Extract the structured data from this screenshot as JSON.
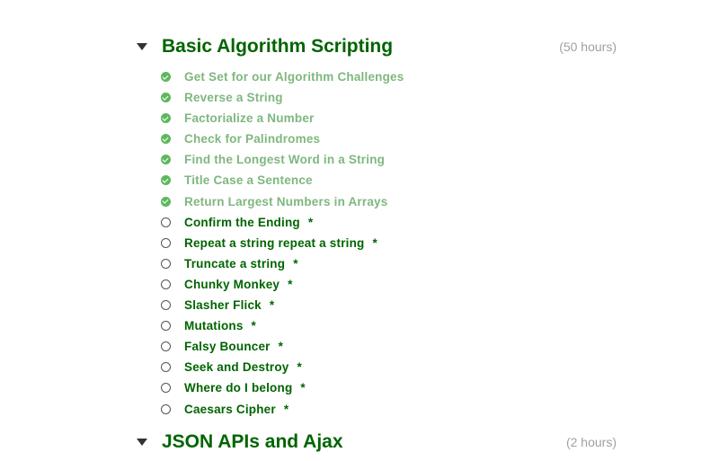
{
  "sections": [
    {
      "title": "Basic Algorithm Scripting",
      "hours": "(50 hours)"
    },
    {
      "title": "JSON APIs and Ajax",
      "hours": "(2 hours)"
    }
  ],
  "new_marker": "*",
  "challenges": [
    {
      "label": "Get Set for our Algorithm Challenges",
      "completed": true
    },
    {
      "label": "Reverse a String",
      "completed": true
    },
    {
      "label": "Factorialize a Number",
      "completed": true
    },
    {
      "label": "Check for Palindromes",
      "completed": true
    },
    {
      "label": "Find the Longest Word in a String",
      "completed": true
    },
    {
      "label": "Title Case a Sentence",
      "completed": true
    },
    {
      "label": "Return Largest Numbers in Arrays",
      "completed": true
    },
    {
      "label": "Confirm the Ending",
      "completed": false
    },
    {
      "label": "Repeat a string repeat a string",
      "completed": false
    },
    {
      "label": "Truncate a string",
      "completed": false
    },
    {
      "label": "Chunky Monkey",
      "completed": false
    },
    {
      "label": "Slasher Flick",
      "completed": false
    },
    {
      "label": "Mutations",
      "completed": false
    },
    {
      "label": "Falsy Bouncer",
      "completed": false
    },
    {
      "label": "Seek and Destroy",
      "completed": false
    },
    {
      "label": "Where do I belong",
      "completed": false
    },
    {
      "label": "Caesars Cipher",
      "completed": false
    }
  ],
  "colors": {
    "section_title": "#006400",
    "completed_text": "#7fb77f",
    "incomplete_text": "#006400",
    "completed_icon": "#5cb85c",
    "hours_text": "#a0a0a0"
  }
}
